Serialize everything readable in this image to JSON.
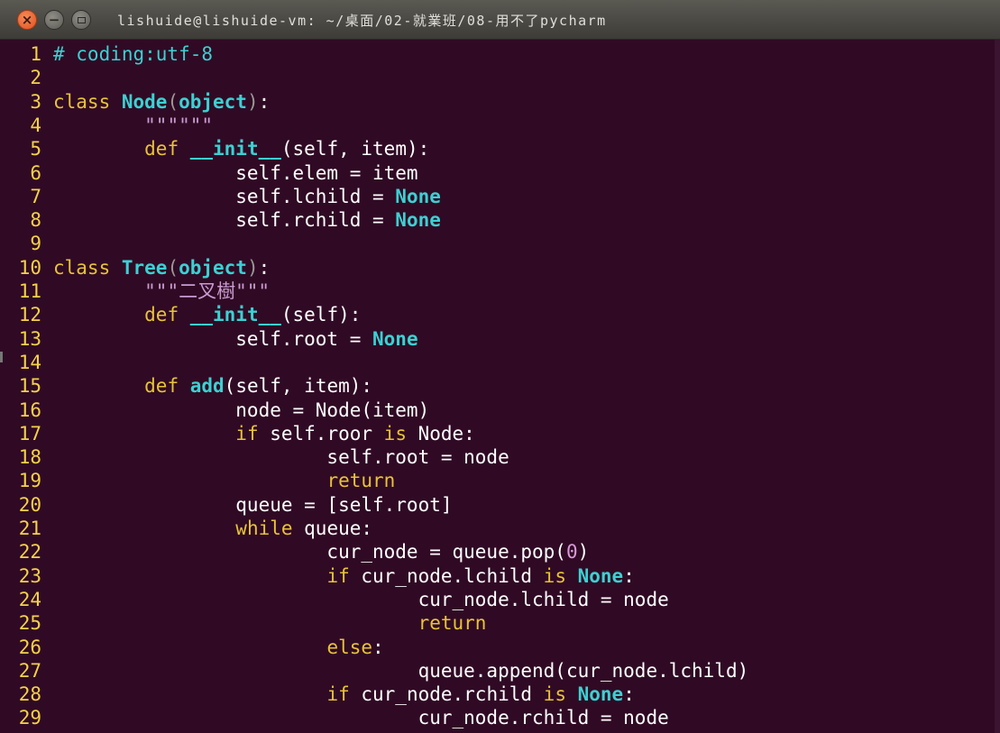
{
  "window": {
    "title": "lishuide@lishuide-vm: ~/桌面/02-就業班/08-用不了pycharm",
    "buttons": {
      "close": "×",
      "minimize": "−"
    }
  },
  "editor": {
    "lines": [
      {
        "n": "1",
        "tokens": [
          [
            "cm",
            "# coding:utf-8"
          ]
        ]
      },
      {
        "n": "2",
        "tokens": []
      },
      {
        "n": "3",
        "tokens": [
          [
            "kw",
            "class "
          ],
          [
            "tp",
            "Node"
          ],
          [
            "br",
            "("
          ],
          [
            "tp",
            "object"
          ],
          [
            "br",
            ")"
          ],
          [
            "pl",
            ":"
          ]
        ]
      },
      {
        "n": "4",
        "tokens": [
          [
            "pl",
            "        "
          ],
          [
            "st",
            "\"\"\"\"\"\""
          ]
        ]
      },
      {
        "n": "5",
        "tokens": [
          [
            "pl",
            "        "
          ],
          [
            "kw",
            "def "
          ],
          [
            "tp",
            "__init__"
          ],
          [
            "pl",
            "(self, item):"
          ]
        ]
      },
      {
        "n": "6",
        "tokens": [
          [
            "pl",
            "                self.elem = item"
          ]
        ]
      },
      {
        "n": "7",
        "tokens": [
          [
            "pl",
            "                self.lchild = "
          ],
          [
            "tp",
            "None"
          ]
        ]
      },
      {
        "n": "8",
        "tokens": [
          [
            "pl",
            "                self.rchild = "
          ],
          [
            "tp",
            "None"
          ]
        ]
      },
      {
        "n": "9",
        "tokens": []
      },
      {
        "n": "10",
        "tokens": [
          [
            "kw",
            "class "
          ],
          [
            "tp",
            "Tree"
          ],
          [
            "br",
            "("
          ],
          [
            "tp",
            "object"
          ],
          [
            "br",
            ")"
          ],
          [
            "pl",
            ":"
          ]
        ]
      },
      {
        "n": "11",
        "tokens": [
          [
            "pl",
            "        "
          ],
          [
            "st",
            "\"\"\"二叉樹\"\"\""
          ]
        ]
      },
      {
        "n": "12",
        "tokens": [
          [
            "pl",
            "        "
          ],
          [
            "kw",
            "def "
          ],
          [
            "tp",
            "__init__"
          ],
          [
            "pl",
            "(self):"
          ]
        ]
      },
      {
        "n": "13",
        "tokens": [
          [
            "pl",
            "                self.root = "
          ],
          [
            "tp",
            "None"
          ]
        ]
      },
      {
        "n": "14",
        "tokens": []
      },
      {
        "n": "15",
        "tokens": [
          [
            "pl",
            "        "
          ],
          [
            "kw",
            "def "
          ],
          [
            "tp",
            "add"
          ],
          [
            "pl",
            "(self, item):"
          ]
        ]
      },
      {
        "n": "16",
        "tokens": [
          [
            "pl",
            "                node = Node(item)"
          ]
        ]
      },
      {
        "n": "17",
        "tokens": [
          [
            "pl",
            "                "
          ],
          [
            "kw",
            "if "
          ],
          [
            "pl",
            "self.roor "
          ],
          [
            "kw",
            "is "
          ],
          [
            "pl",
            "Node:"
          ]
        ]
      },
      {
        "n": "18",
        "tokens": [
          [
            "pl",
            "                        self.root = node"
          ]
        ]
      },
      {
        "n": "19",
        "tokens": [
          [
            "pl",
            "                        "
          ],
          [
            "kw",
            "return"
          ]
        ]
      },
      {
        "n": "20",
        "tokens": [
          [
            "pl",
            "                queue = [self.root]"
          ]
        ]
      },
      {
        "n": "21",
        "tokens": [
          [
            "pl",
            "                "
          ],
          [
            "kw",
            "while "
          ],
          [
            "pl",
            "queue:"
          ]
        ]
      },
      {
        "n": "22",
        "tokens": [
          [
            "pl",
            "                        cur_node = queue.pop("
          ],
          [
            "nm",
            "0"
          ],
          [
            "pl",
            ")"
          ]
        ]
      },
      {
        "n": "23",
        "tokens": [
          [
            "pl",
            "                        "
          ],
          [
            "kw",
            "if "
          ],
          [
            "pl",
            "cur_node.lchild "
          ],
          [
            "kw",
            "is "
          ],
          [
            "tp",
            "None"
          ],
          [
            "pl",
            ":"
          ]
        ]
      },
      {
        "n": "24",
        "tokens": [
          [
            "pl",
            "                                cur_node.lchild = node"
          ]
        ]
      },
      {
        "n": "25",
        "tokens": [
          [
            "pl",
            "                                "
          ],
          [
            "kw",
            "return"
          ]
        ]
      },
      {
        "n": "26",
        "tokens": [
          [
            "pl",
            "                        "
          ],
          [
            "kw",
            "else"
          ],
          [
            "pl",
            ":"
          ]
        ]
      },
      {
        "n": "27",
        "tokens": [
          [
            "pl",
            "                                queue.append(cur_node.lchild)"
          ]
        ]
      },
      {
        "n": "28",
        "tokens": [
          [
            "pl",
            "                        "
          ],
          [
            "kw",
            "if "
          ],
          [
            "pl",
            "cur_node.rchild "
          ],
          [
            "kw",
            "is "
          ],
          [
            "tp",
            "None"
          ],
          [
            "pl",
            ":"
          ]
        ]
      },
      {
        "n": "29",
        "tokens": [
          [
            "pl",
            "                                cur_node.rchild = node"
          ]
        ]
      }
    ]
  }
}
